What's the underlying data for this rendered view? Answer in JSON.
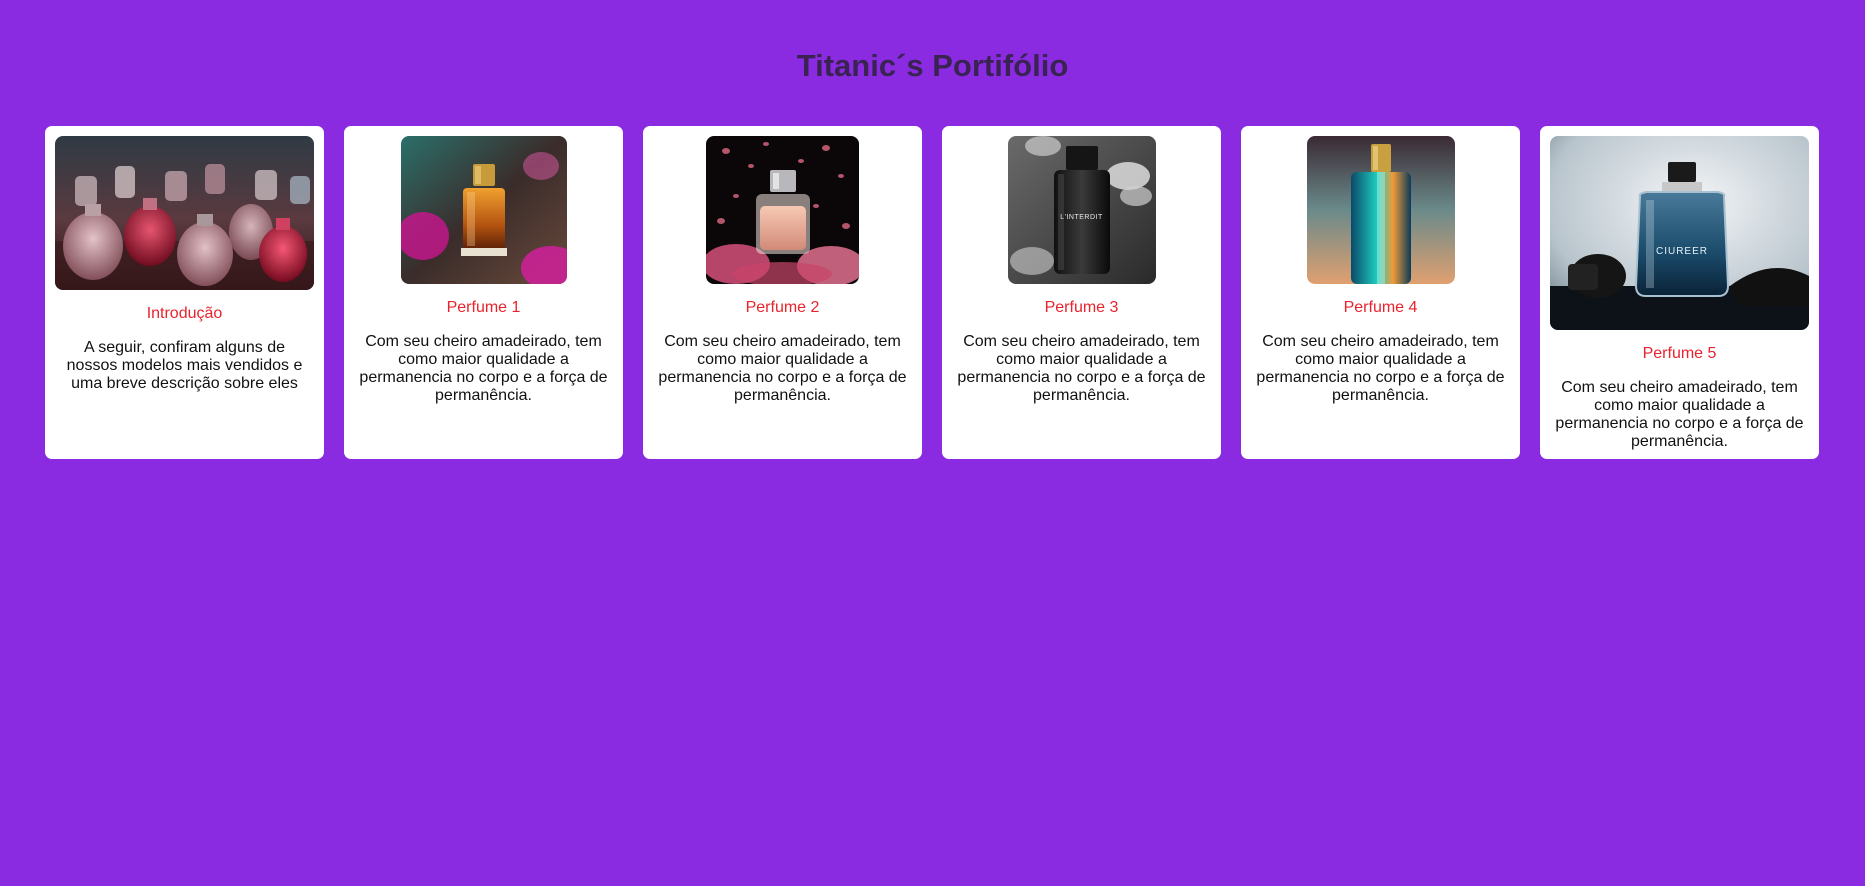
{
  "page": {
    "title": "Titanic´s Portifólio",
    "background": "#8a2be2"
  },
  "cards": [
    {
      "title": "Introdução",
      "text": "A seguir, confiram alguns de nossos modelos mais vendidos e uma breve descrição sobre eles",
      "image": "perfume-collection-photo"
    },
    {
      "title": "Perfume 1",
      "text": "Com seu cheiro amadeirado, tem como maior qualidade a permanencia no corpo e a força de permanência.",
      "image": "amber-perfume-photo"
    },
    {
      "title": "Perfume 2",
      "text": "Com seu cheiro amadeirado, tem como maior qualidade a permanencia no corpo e a força de permanência.",
      "image": "rose-perfume-photo"
    },
    {
      "title": "Perfume 3",
      "text": "Com seu cheiro amadeirado, tem como maior qualidade a permanencia no corpo e a força de permanência.",
      "image": "black-perfume-photo",
      "bottle_label": "L'INTERDIT"
    },
    {
      "title": "Perfume 4",
      "text": "Com seu cheiro amadeirado, tem como maior qualidade a permanencia no corpo e a força de permanência.",
      "image": "teal-perfume-photo"
    },
    {
      "title": "Perfume 5",
      "text": "Com seu cheiro amadeirado, tem como maior qualidade a permanencia no corpo e a força de permanência.",
      "image": "blue-perfume-photo",
      "bottle_label": "CIUREER"
    }
  ],
  "colors": {
    "title": "#3a2352",
    "card_title": "#e8232e",
    "card_text": "#111111",
    "card_background": "#ffffff"
  }
}
